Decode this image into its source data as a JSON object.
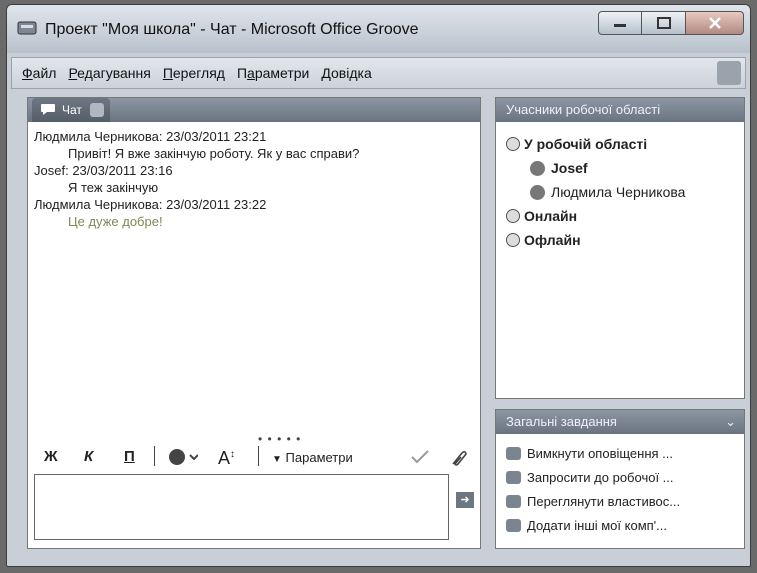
{
  "window": {
    "title": "Проект \"Моя школа\" - Чат - Microsoft Office Groove",
    "controls": [
      "minimize",
      "maximize",
      "close"
    ]
  },
  "menubar": {
    "items": [
      "Файл",
      "Редагування",
      "Перегляд",
      "Параметри",
      "Довідка"
    ],
    "underlined": [
      "Ф",
      "Р",
      "П",
      "а",
      "Д"
    ]
  },
  "chat": {
    "tab_label": "Чат",
    "messages": [
      {
        "author": "Людмила Черникова:",
        "time": "23/03/2011 23:21",
        "text": "Привіт! Я вже закінчую роботу. Як у вас справи?"
      },
      {
        "author": "Josef:",
        "time": "23/03/2011 23:16",
        "text": "Я теж закінчую"
      },
      {
        "author": "Людмила Черникова:",
        "time": "23/03/2011 23:22",
        "text": "Це дуже добре!"
      }
    ],
    "toolbar": {
      "bold": "Ж",
      "italic": "К",
      "underline": "П",
      "font_color": "A",
      "options_label": "Параметри"
    }
  },
  "members": {
    "header": "Учасники робочої області",
    "groups": [
      {
        "label": "У робочій області",
        "members": [
          "Josef",
          "Людмила Черникова"
        ]
      },
      {
        "label": "Онлайн",
        "members": []
      },
      {
        "label": "Офлайн",
        "members": []
      }
    ]
  },
  "tasks": {
    "header": "Загальні завдання",
    "items": [
      "Вимкнути оповіщення ...",
      "Запросити до робочої ...",
      "Переглянути властивос...",
      "Додати інші мої комп'..."
    ]
  },
  "colors": {
    "pane_header": "#7b8590",
    "window_bg": "#c9cfd6"
  }
}
